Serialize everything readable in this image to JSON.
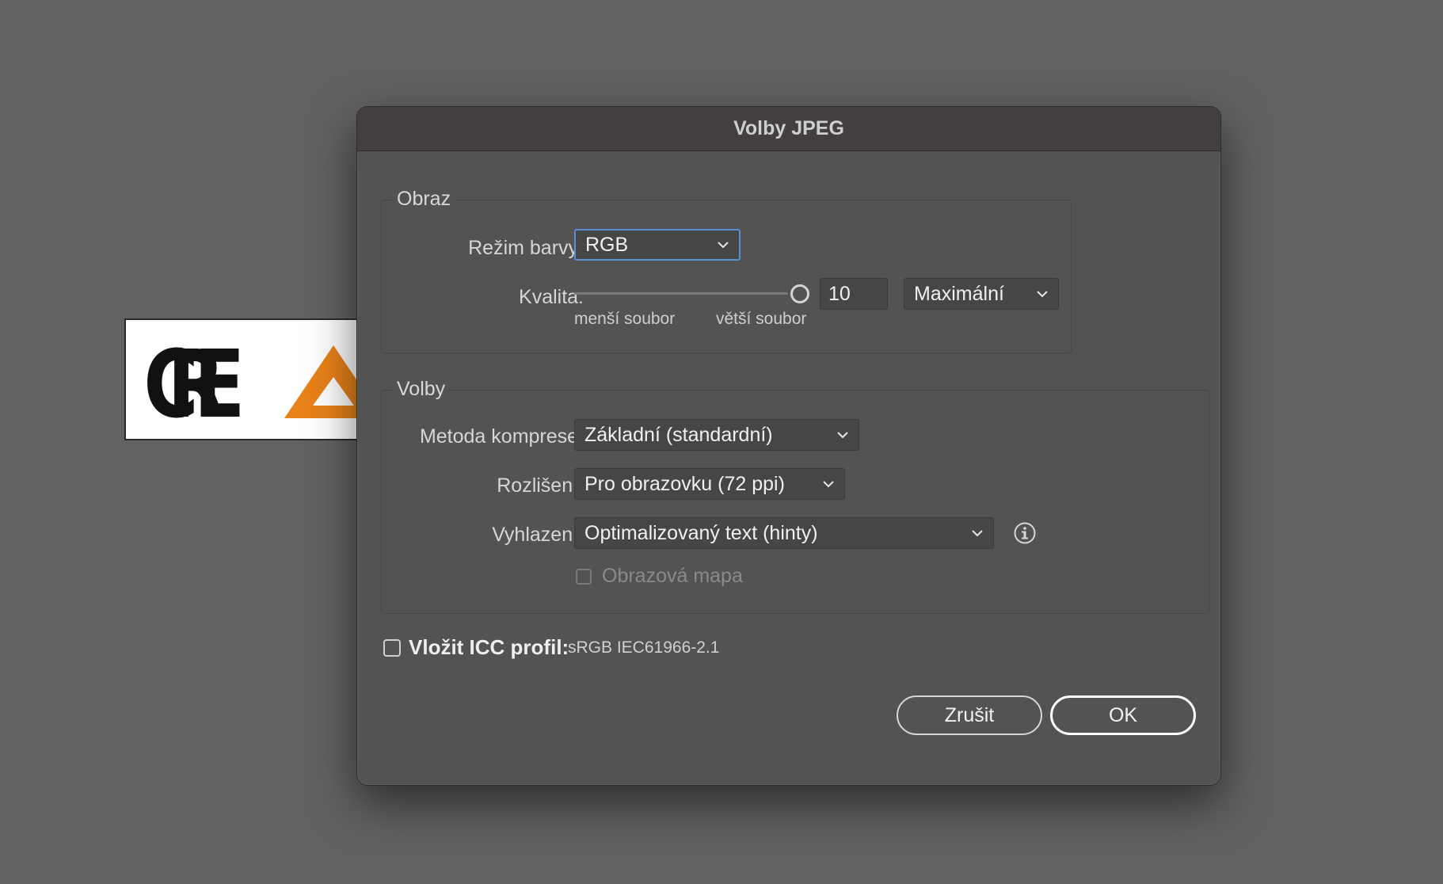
{
  "artwork": {
    "logo_text": "CRE",
    "accent_color": "#e8821a"
  },
  "dialog": {
    "title": "Volby JPEG",
    "image_group": {
      "label": "Obraz",
      "color_mode_label": "Režim barvy:",
      "color_mode_value": "RGB",
      "quality_label": "Kvalita:",
      "quality_value": "10",
      "quality_level": 1.0,
      "quality_preset": "Maximální",
      "smaller_file": "menší soubor",
      "larger_file": "větší soubor"
    },
    "options_group": {
      "label": "Volby",
      "compression_label": "Metoda komprese:",
      "compression_value": "Základní (standardní)",
      "resolution_label": "Rozlišení:",
      "resolution_value": "Pro obrazovku (72 ppi)",
      "antialias_label": "Vyhlazení:",
      "antialias_value": "Optimalizovaný text (hinty)",
      "image_map_label": "Obrazová mapa",
      "image_map_checked": false
    },
    "icc": {
      "label": "Vložit ICC profil:",
      "value": "sRGB IEC61966-2.1",
      "checked": false
    },
    "buttons": {
      "cancel": "Zrušit",
      "ok": "OK"
    }
  }
}
